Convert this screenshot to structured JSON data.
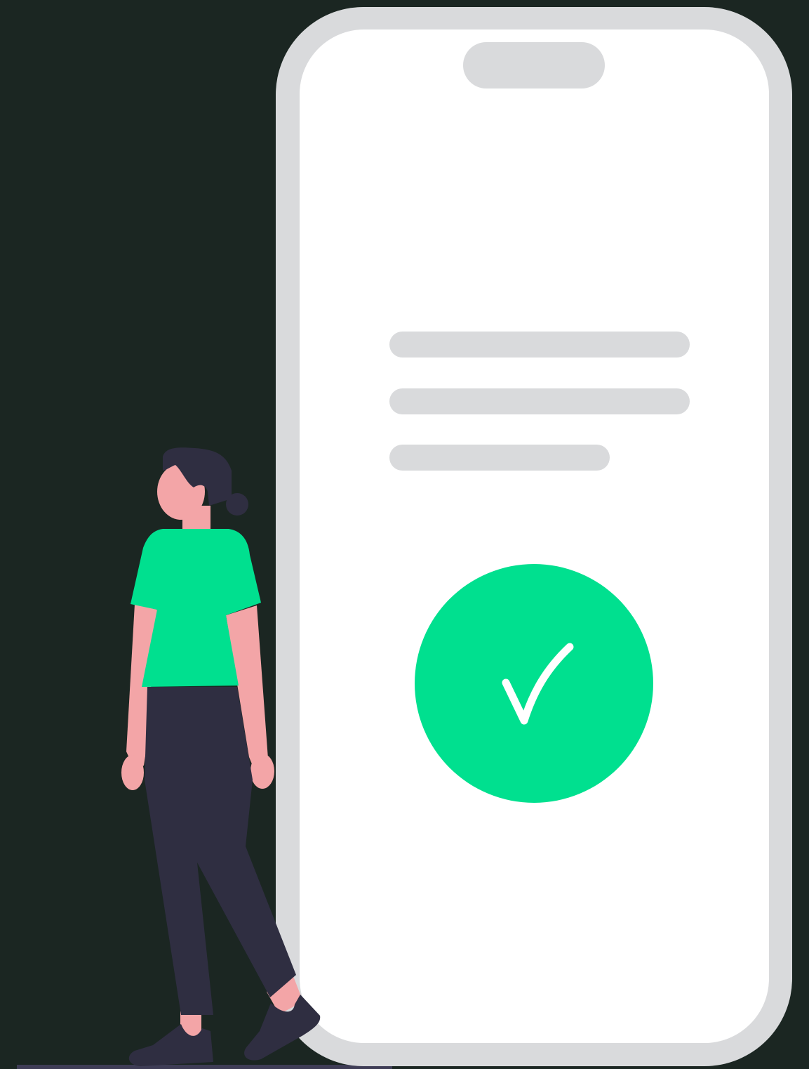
{
  "illustration": {
    "subject": "person-standing-next-to-phone-with-success-check",
    "colors": {
      "background": "#1b2622",
      "phone_frame": "#d9dadc",
      "phone_screen": "#ffffff",
      "notch": "#d9dadc",
      "placeholder_line": "#d9dadc",
      "check_circle": "#00e08f",
      "check_mark": "#ffffff",
      "shirt": "#00e08f",
      "skin": "#f3a5a7",
      "hair": "#2f2e41",
      "pants": "#2f2e41",
      "shoes": "#2f2e41",
      "floor": "#3f3d56"
    },
    "icons": [
      "check-icon"
    ]
  }
}
